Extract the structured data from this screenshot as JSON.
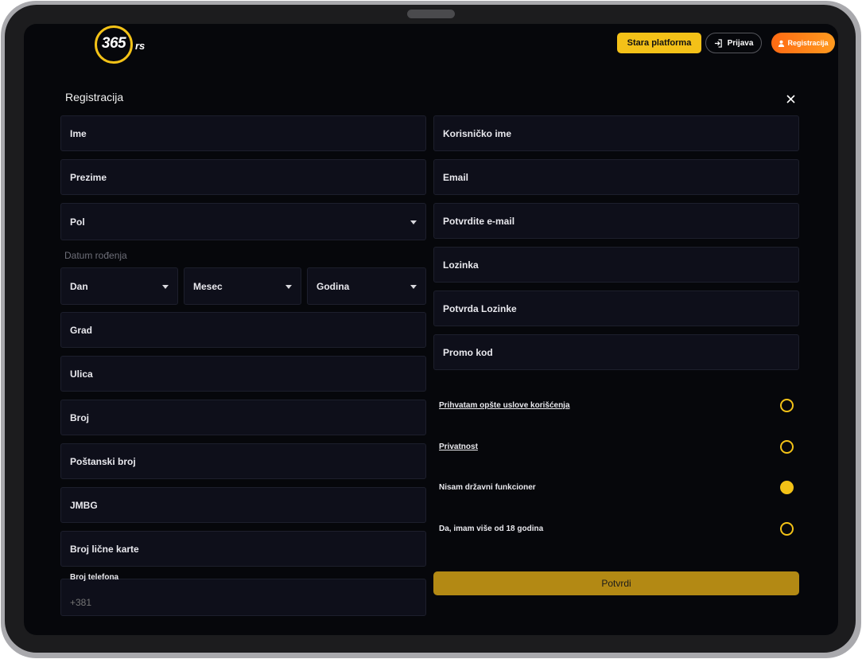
{
  "header": {
    "logo_number": "365",
    "logo_suffix": "rs",
    "old_platform_label": "Stara platforma",
    "login_label": "Prijava",
    "register_label": "Registracija"
  },
  "modal": {
    "title": "Registracija"
  },
  "left_fields": {
    "first_name": "Ime",
    "last_name": "Prezime",
    "gender": "Pol",
    "dob_label": "Datum rođenja",
    "day": "Dan",
    "month": "Mesec",
    "year": "Godina",
    "city": "Grad",
    "street": "Ulica",
    "number": "Broj",
    "postal_code": "Poštanski broj",
    "jmbg": "JMBG",
    "id_card": "Broj lične karte",
    "phone_label": "Broj telefona",
    "phone_placeholder": "+381"
  },
  "right_fields": {
    "username": "Korisničko ime",
    "email": "Email",
    "email_confirm": "Potvrdite e-mail",
    "password": "Lozinka",
    "password_confirm": "Potvrda Lozinke",
    "promo": "Promo kod"
  },
  "checks": [
    {
      "label": "Prihvatam opšte uslove korišćenja",
      "checked": false,
      "link": true
    },
    {
      "label": "Privatnost",
      "checked": false,
      "link": true
    },
    {
      "label": "Nisam državni funkcioner",
      "checked": true,
      "link": false
    },
    {
      "label": "Da, imam više od 18 godina",
      "checked": false,
      "link": false
    }
  ],
  "submit_label": "Potvrdi",
  "colors": {
    "accent": "#f3c217",
    "submit": "#b38914",
    "register_gradient": "#ff6a13",
    "background": "#06070b",
    "field": "#0e0f1a"
  }
}
